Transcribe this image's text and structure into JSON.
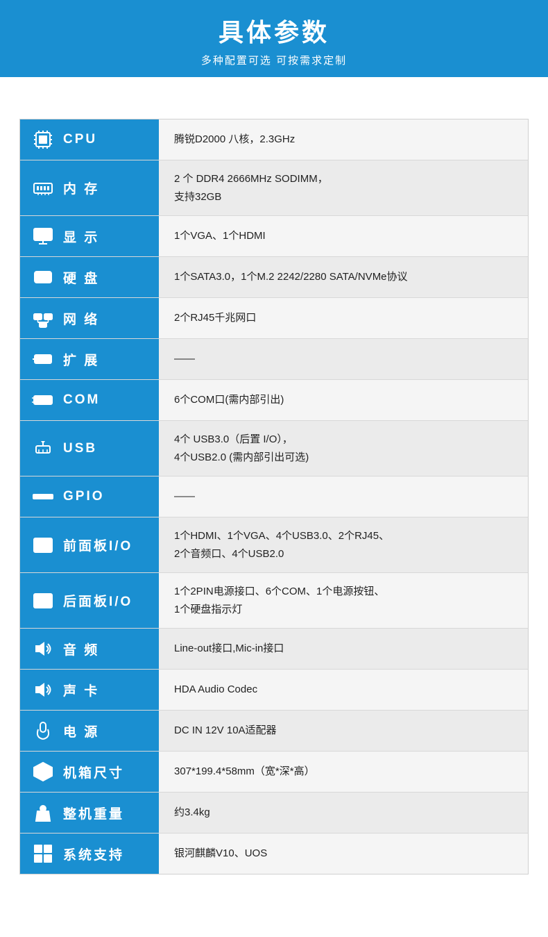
{
  "header": {
    "title": "具体参数",
    "subtitle": "多种配置可选 可按需求定制"
  },
  "rows": [
    {
      "id": "cpu",
      "label": "CPU",
      "value": "腾锐D2000 八核，2.3GHz",
      "icon": "cpu"
    },
    {
      "id": "memory",
      "label": "内 存",
      "value": "2 个 DDR4 2666MHz SODIMM，\n支持32GB",
      "icon": "memory"
    },
    {
      "id": "display",
      "label": "显 示",
      "value": "1个VGA、1个HDMI",
      "icon": "display"
    },
    {
      "id": "harddisk",
      "label": "硬 盘",
      "value": "1个SATA3.0，1个M.2 2242/2280 SATA/NVMe协议",
      "icon": "harddisk"
    },
    {
      "id": "network",
      "label": "网 络",
      "value": "2个RJ45千兆网口",
      "icon": "network"
    },
    {
      "id": "expand",
      "label": "扩 展",
      "value": "——",
      "icon": "expand"
    },
    {
      "id": "com",
      "label": "COM",
      "value": "6个COM口(需内部引出)",
      "icon": "com"
    },
    {
      "id": "usb",
      "label": "USB",
      "value": "4个 USB3.0（后置 I/O），\n4个USB2.0 (需内部引出可选)",
      "icon": "usb"
    },
    {
      "id": "gpio",
      "label": "GPIO",
      "value": "——",
      "icon": "gpio"
    },
    {
      "id": "front-io",
      "label": "前面板I/O",
      "value": "1个HDMI、1个VGA、4个USB3.0、2个RJ45、\n2个音频口、4个USB2.0",
      "icon": "front-panel"
    },
    {
      "id": "rear-io",
      "label": "后面板I/O",
      "value": "1个2PIN电源接口、6个COM、1个电源按钮、\n1个硬盘指示灯",
      "icon": "rear-panel"
    },
    {
      "id": "audio",
      "label": "音 频",
      "value": "Line-out接口,Mic-in接口",
      "icon": "audio"
    },
    {
      "id": "soundcard",
      "label": "声 卡",
      "value": "HDA Audio Codec",
      "icon": "soundcard"
    },
    {
      "id": "power",
      "label": "电 源",
      "value": "DC IN 12V 10A适配器",
      "icon": "power"
    },
    {
      "id": "chassis",
      "label": "机箱尺寸",
      "value": "307*199.4*58mm（宽*深*高）",
      "icon": "chassis"
    },
    {
      "id": "weight",
      "label": "整机重量",
      "value": "约3.4kg",
      "icon": "weight"
    },
    {
      "id": "os",
      "label": "系统支持",
      "value": "银河麒麟V10、UOS",
      "icon": "os"
    }
  ]
}
